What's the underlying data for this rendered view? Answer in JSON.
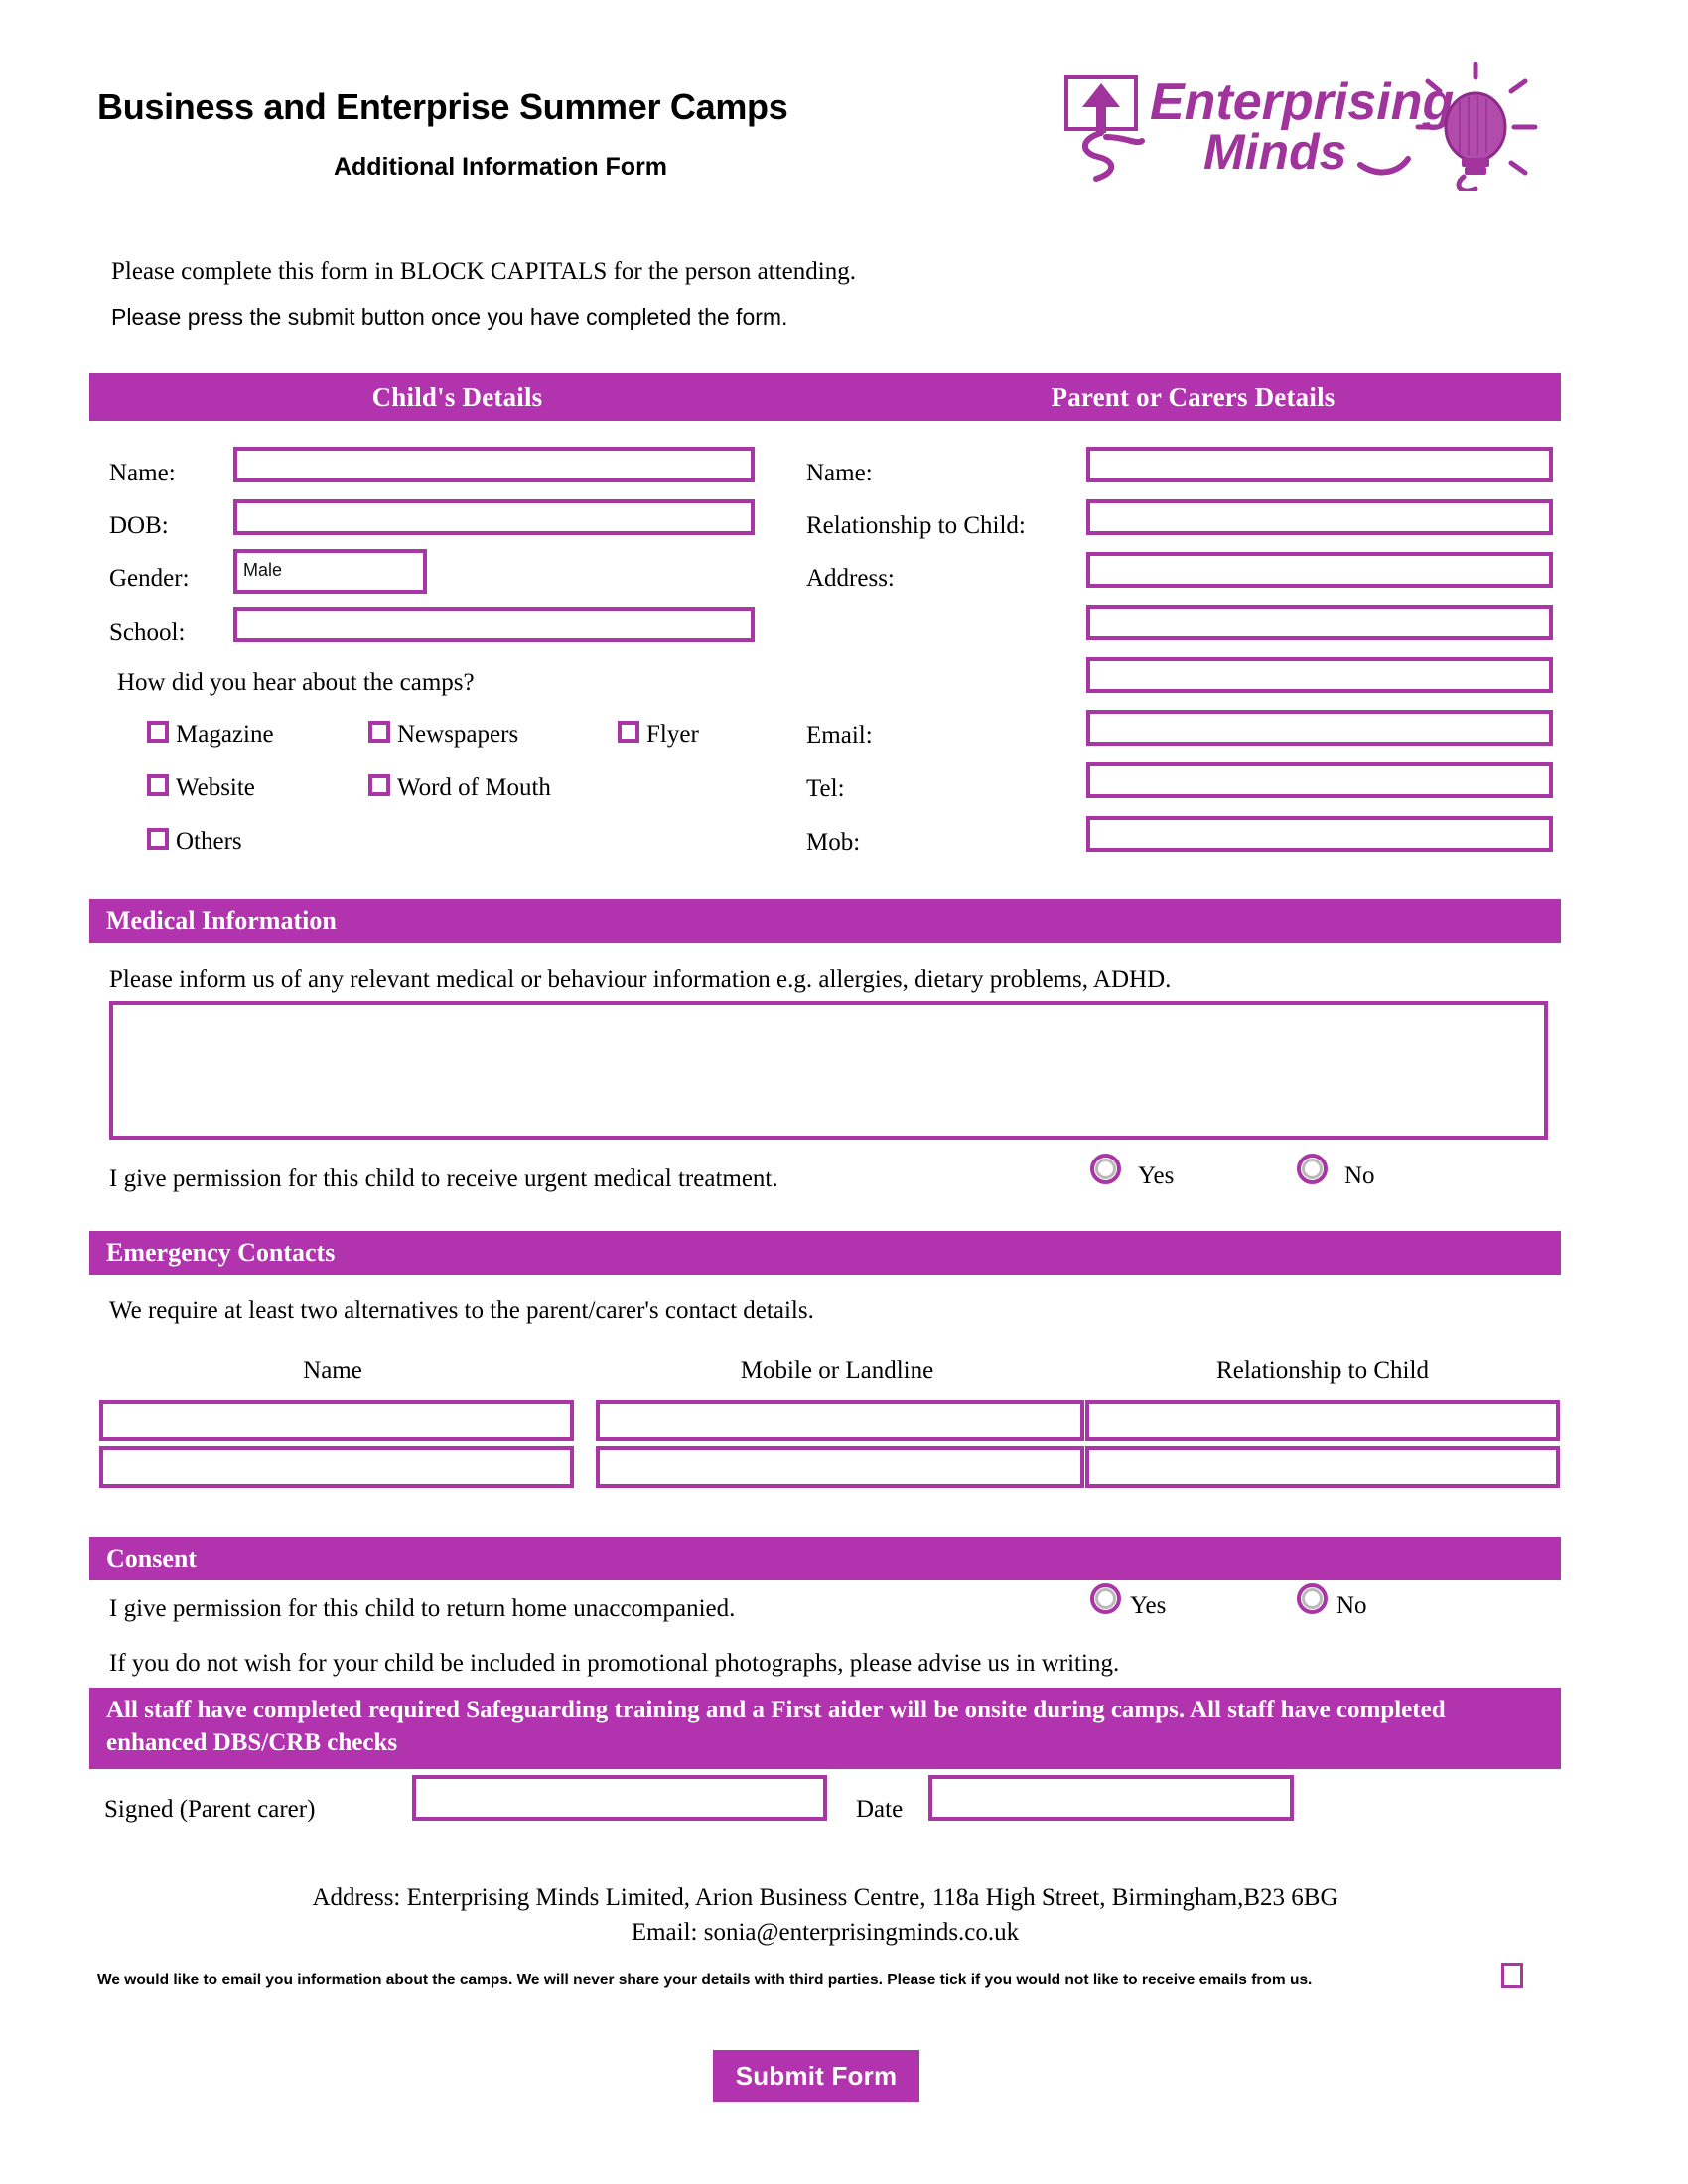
{
  "header": {
    "title": "Business and Enterprise Summer Camps",
    "subtitle": "Additional Information Form",
    "logo_line1": "Enterprising",
    "logo_line2": "Minds",
    "logo_icon": "lightbulb-icon"
  },
  "intro": {
    "line1": "Please complete this form in BLOCK CAPITALS for the person attending.",
    "line2": "Please press the submit button once you have completed the form."
  },
  "colors": {
    "band": "#b233ae",
    "border": "#a836a4",
    "text": "#000000",
    "band_text": "#ffffff"
  },
  "section_headers": {
    "child": "Child's Details",
    "parent": "Parent or Carers Details",
    "medical": "Medical Information",
    "emergency": "Emergency Contacts",
    "consent": "Consent"
  },
  "child": {
    "fields": [
      {
        "label": "Name:",
        "value": ""
      },
      {
        "label": "DOB:",
        "value": ""
      },
      {
        "label": "Gender:",
        "value": "Male"
      },
      {
        "label": "School:",
        "value": ""
      }
    ],
    "hear_question": "How did you hear about the camps?",
    "hear_options": [
      {
        "label": "Magazine",
        "checked": false
      },
      {
        "label": "Newspapers",
        "checked": false
      },
      {
        "label": "Flyer",
        "checked": false
      },
      {
        "label": "Website",
        "checked": false
      },
      {
        "label": "Word of Mouth",
        "checked": false
      },
      {
        "label": "Others",
        "checked": false
      }
    ]
  },
  "parent": {
    "fields": [
      {
        "label": "Name:",
        "value": ""
      },
      {
        "label": "Relationship to Child:",
        "value": ""
      },
      {
        "label": "Address:",
        "value": ""
      },
      {
        "label": "",
        "value": ""
      },
      {
        "label": "",
        "value": ""
      },
      {
        "label": "Email:",
        "value": ""
      },
      {
        "label": "Tel:",
        "value": ""
      },
      {
        "label": "Mob:",
        "value": ""
      }
    ]
  },
  "medical": {
    "prompt": "Please inform us of any relevant medical or behaviour information e.g. allergies, dietary problems, ADHD.",
    "notes_value": "",
    "permission_text": "I give permission for this child to receive urgent medical treatment.",
    "yes_label": "Yes",
    "no_label": "No"
  },
  "emergency": {
    "note": "We require at least two alternatives to the parent/carer's contact details.",
    "columns": [
      "Name",
      "Mobile or Landline",
      "Relationship to Child"
    ],
    "rows": [
      {
        "name": "",
        "phone": "",
        "relationship": ""
      },
      {
        "name": "",
        "phone": "",
        "relationship": ""
      }
    ]
  },
  "consent": {
    "permission_text": "I give permission for this child to return home unaccompanied.",
    "yes_label": "Yes",
    "no_label": "No",
    "photo_text": "If you do not wish for your child be included in promotional photographs, please advise us in writing.",
    "safeguarding_notice": "All staff have completed required Safeguarding training and a First aider will be onsite during camps. All staff have completed enhanced DBS/CRB checks"
  },
  "signature": {
    "signed_label": "Signed (Parent carer)",
    "signed_value": "",
    "date_label": "Date",
    "date_value": ""
  },
  "footer": {
    "address": "Address: Enterprising Minds Limited, Arion Business Centre, 118a High Street, Birmingham,B23 6BG",
    "email": "Email: sonia@enterprisingminds.co.uk",
    "optout_text": "We would like to email you information about the camps. We will never share your details with third parties. Please tick if you would not like to receive emails from us.",
    "optout_checked": false,
    "submit_label": "Submit Form"
  }
}
